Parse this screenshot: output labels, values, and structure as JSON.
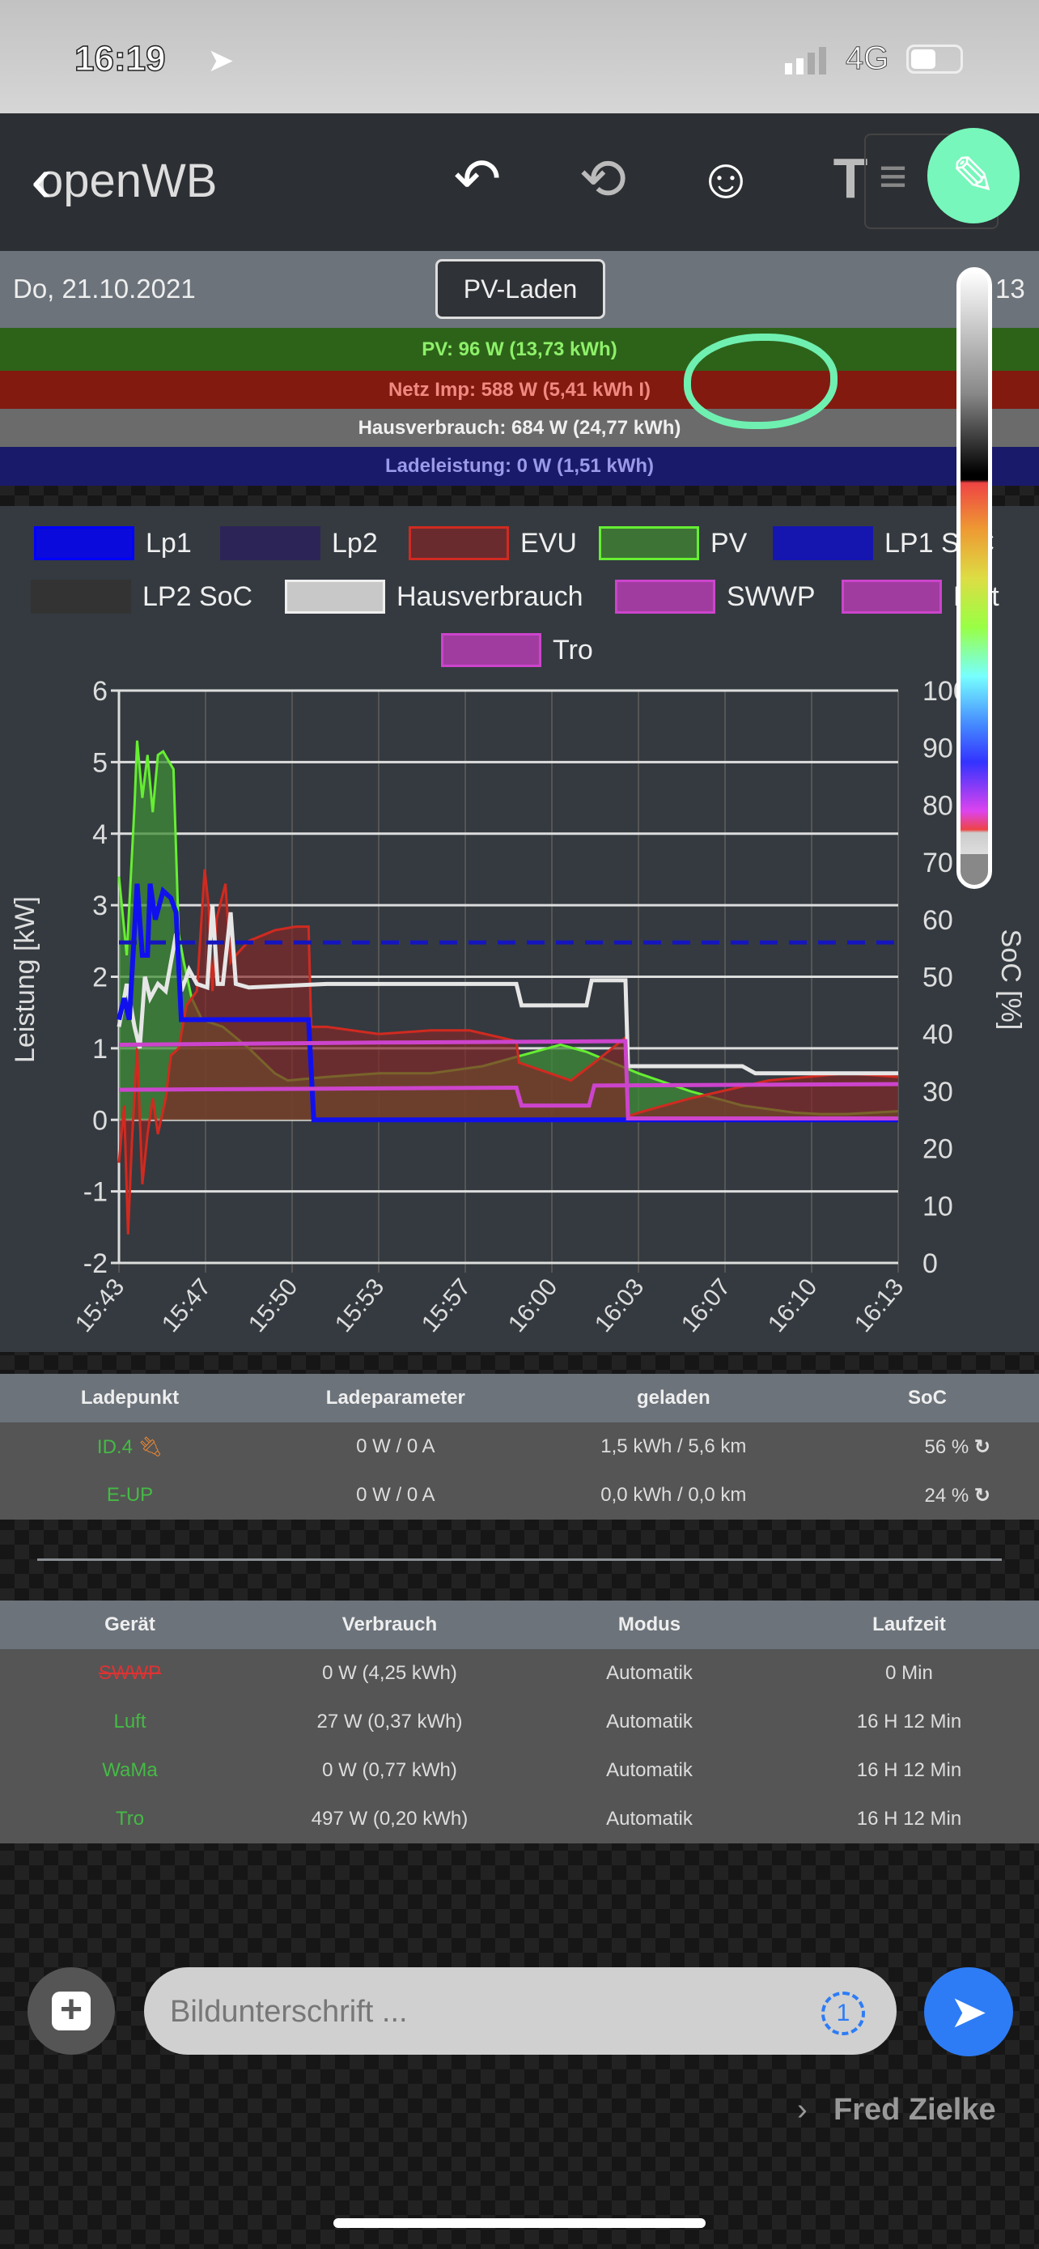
{
  "status_bar": {
    "time": "16:19",
    "network": "4G"
  },
  "toolbar": {
    "title": "openWB"
  },
  "header": {
    "date": "Do, 21.10.2021",
    "mode": "PV-Laden",
    "clock_partial": "13"
  },
  "bars": [
    {
      "text": "PV: 96 W (13,73 kWh)",
      "bg": "#2d6319",
      "fg": "#8ef06a"
    },
    {
      "text": "Netz Imp: 588 W (5,41 kWh I)",
      "bg": "#821a10",
      "fg": "#f08a80"
    },
    {
      "text": "Hausverbrauch: 684 W (24,77 kWh)",
      "bg": "#6b6b6b",
      "fg": "#f0f0f0"
    },
    {
      "text": "Ladeleistung: 0 W (1,51 kWh)",
      "bg": "#1a1a6b",
      "fg": "#9a9ae8"
    }
  ],
  "chart_data": {
    "type": "line",
    "ylabel": "Leistung [kW]",
    "y2label": "SoC [%]",
    "ylim": [
      -2,
      6
    ],
    "y2lim": [
      0,
      100
    ],
    "yticks": [
      "-2",
      "-1",
      "0",
      "1",
      "2",
      "3",
      "4",
      "5",
      "6"
    ],
    "y2ticks": [
      "0",
      "10",
      "20",
      "30",
      "40",
      "50",
      "60",
      "70",
      "80",
      "90",
      "100"
    ],
    "xlim": [
      0,
      30
    ],
    "xticks": [
      "15:43",
      "15:47",
      "15:50",
      "15:53",
      "15:57",
      "16:00",
      "16:03",
      "16:07",
      "16:10",
      "16:13"
    ],
    "legend": [
      {
        "name": "Lp1",
        "color": "#0000ff",
        "fill": "#0a0adc"
      },
      {
        "name": "Lp2",
        "color": "#2c2456",
        "fill": "#2c2456"
      },
      {
        "name": "EVU",
        "color": "#d12a20",
        "fill": "#6a2b2f"
      },
      {
        "name": "PV",
        "color": "#66ee33",
        "fill": "#3d7436"
      },
      {
        "name": "LP1 SoC",
        "color": "#1515b0",
        "fill": "#1515b0"
      },
      {
        "name": "LP2 SoC",
        "color": "#333",
        "fill": "#333"
      },
      {
        "name": "Hausverbrauch",
        "color": "#eeeeee",
        "fill": "#c8c8c8"
      },
      {
        "name": "SWWP",
        "color": "#cc44cc",
        "fill": "#a03ca0"
      },
      {
        "name": "Luft",
        "color": "#cc44cc",
        "fill": "#a03ca0"
      },
      {
        "name": "Tro",
        "color": "#cc44cc",
        "fill": "#a03ca0"
      }
    ],
    "series": [
      {
        "name": "PV",
        "x": [
          0,
          0.3,
          0.6,
          0.7,
          0.9,
          1.1,
          1.3,
          1.5,
          1.7,
          2.1,
          2.3,
          2.5,
          2.8,
          3.2,
          4,
          5,
          6,
          6.5,
          8,
          10,
          12,
          14,
          16,
          17,
          18,
          20,
          22,
          24,
          26,
          27,
          28,
          30
        ],
        "y": [
          3.4,
          2.3,
          4.4,
          5.3,
          4.5,
          5.1,
          4.3,
          5.1,
          5.15,
          4.9,
          2.6,
          2.2,
          1.7,
          1.4,
          1.3,
          1.0,
          0.65,
          0.55,
          0.6,
          0.65,
          0.65,
          0.75,
          0.95,
          1.05,
          0.95,
          0.65,
          0.4,
          0.2,
          0.1,
          0.08,
          0.08,
          0.12
        ]
      },
      {
        "name": "EVU",
        "x": [
          0,
          0.2,
          0.35,
          0.5,
          0.7,
          0.9,
          1.1,
          1.3,
          1.5,
          1.8,
          2.0,
          2.3,
          2.6,
          3.0,
          3.3,
          3.45,
          3.6,
          3.75,
          4.1,
          4.3,
          4.5,
          5.0,
          6.0,
          6.8,
          7.3,
          7.4,
          8,
          10,
          12,
          13.5,
          15.3,
          15.4,
          17.4,
          18.3,
          19.5,
          19.6,
          20,
          22,
          25,
          28,
          30
        ],
        "y": [
          -0.6,
          0.2,
          -1.6,
          -0.3,
          1.0,
          -0.9,
          -0.2,
          0.3,
          -0.2,
          0.3,
          0.9,
          1.0,
          1.6,
          1.8,
          3.5,
          3.0,
          1.8,
          2.8,
          3.3,
          2.2,
          2.3,
          2.5,
          2.65,
          2.7,
          2.7,
          1.3,
          1.3,
          1.2,
          1.25,
          1.25,
          1.1,
          0.8,
          0.55,
          0.8,
          1.15,
          0.05,
          0.1,
          0.3,
          0.55,
          0.65,
          0.6
        ]
      },
      {
        "name": "Hausverbrauch",
        "x": [
          0,
          0.3,
          0.6,
          0.8,
          1.0,
          1.2,
          1.5,
          1.8,
          2.2,
          2.4,
          2.7,
          3.0,
          3.4,
          3.6,
          3.8,
          4.0,
          4.3,
          4.5,
          5,
          8,
          12,
          15.3,
          15.5,
          18,
          18.2,
          19.5,
          19.6,
          22,
          24,
          24.5,
          30
        ],
        "y": [
          1.3,
          1.9,
          1.3,
          1.0,
          2.0,
          1.7,
          1.9,
          1.8,
          2.6,
          1.8,
          2.1,
          1.9,
          1.85,
          3.0,
          1.9,
          1.9,
          2.9,
          1.9,
          1.85,
          1.9,
          1.9,
          1.9,
          1.6,
          1.6,
          1.95,
          1.95,
          0.75,
          0.75,
          0.75,
          0.65,
          0.65
        ]
      },
      {
        "name": "Lp1",
        "x": [
          0,
          0.2,
          0.4,
          0.7,
          0.9,
          1.1,
          1.2,
          1.4,
          1.7,
          2.0,
          2.2,
          2.4,
          7.3,
          7.5,
          30
        ],
        "y": [
          1.4,
          1.7,
          1.4,
          3.3,
          2.3,
          2.3,
          3.3,
          2.8,
          3.2,
          3.1,
          2.9,
          1.4,
          1.4,
          0,
          0
        ]
      },
      {
        "name": "SWWP",
        "x": [
          0,
          10,
          19.5,
          19.6,
          30
        ],
        "y": [
          1.05,
          1.08,
          1.1,
          0.02,
          0.02
        ]
      },
      {
        "name": "Tro",
        "x": [
          0,
          15.3,
          15.5,
          18.1,
          18.3,
          30
        ],
        "y": [
          0.42,
          0.45,
          0.2,
          0.2,
          0.48,
          0.5
        ]
      },
      {
        "name": "LP1 SoC",
        "axis": "y2",
        "x": [
          0,
          30
        ],
        "y": [
          56,
          56
        ]
      }
    ]
  },
  "charge_table": {
    "headers": [
      "Ladepunkt",
      "Ladeparameter",
      "geladen",
      "SoC"
    ],
    "rows": [
      {
        "name": "ID.4",
        "param": "0 W / 0 A",
        "loaded": "1,5 kWh / 5,6 km",
        "soc": "56 %",
        "plugged": true
      },
      {
        "name": "E-UP",
        "param": "0 W / 0 A",
        "loaded": "0,0 kWh / 0,0 km",
        "soc": "24 %",
        "plugged": false
      }
    ]
  },
  "device_table": {
    "headers": [
      "Gerät",
      "Verbrauch",
      "Modus",
      "Laufzeit"
    ],
    "rows": [
      {
        "name": "SWWP",
        "usage": "0 W (4,25 kWh)",
        "mode": "Automatik",
        "runtime": "0 Min",
        "color": "#d33"
      },
      {
        "name": "Luft",
        "usage": "27 W (0,37 kWh)",
        "mode": "Automatik",
        "runtime": "16 H 12 Min",
        "color": "#4b4"
      },
      {
        "name": "WaMa",
        "usage": "0 W (0,77 kWh)",
        "mode": "Automatik",
        "runtime": "16 H 12 Min",
        "color": "#4b4"
      },
      {
        "name": "Tro",
        "usage": "497 W (0,20 kWh)",
        "mode": "Automatik",
        "runtime": "16 H 12 Min",
        "color": "#4b4"
      }
    ]
  },
  "compose": {
    "caption_placeholder": "Bildunterschrift ...",
    "recipient": "Fred Zielke",
    "view_once": "1"
  }
}
